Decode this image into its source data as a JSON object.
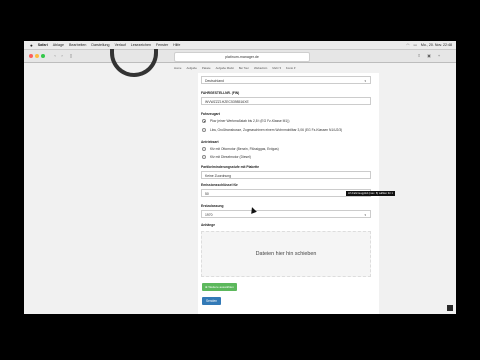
{
  "menubar": {
    "apple": "",
    "app": "Safari",
    "items": [
      "Ablage",
      "Bearbeiten",
      "Darstellung",
      "Verlauf",
      "Lesezeichen",
      "Fenster",
      "Hilfe"
    ],
    "clock": "Mo., 20. Nov. 22:48"
  },
  "toolbar": {
    "url": "platinum-manager.de"
  },
  "nav": {
    "items": [
      "Home",
      "Aufgabe",
      "Pakete",
      "Aufgabe Markt",
      "Bei Tour",
      "Webadmin",
      "Mehr ▾",
      "Konto ▾"
    ]
  },
  "form": {
    "top_select_value": "Deutschland",
    "fahrgestellnr_label": "FAHRGESTELLNR. (FIN)",
    "fahrgestellnr_value": "WVWZZZ1HZEC5398516XE",
    "fahrzeugart_label": "Fahrzeugart",
    "fahrzeugart_opt1": "Pkw (einer Werkmaßstab bis 2,8 t (EG Fz-Klasse M1))",
    "fahrzeugart_opt2": "Lkw, Großtransbusse, Zugmaschinen einem Wohnmobilbar 3,06 (EG Fz-Klassen N1/U2/3)",
    "antriebsart_label": "Antriebsart",
    "antriebsart_opt1": "Kfz mit Ottomotor (Benzin, Flüssiggas, Erdgas)",
    "antriebsart_opt2": "Kfz mit Dieselmotor (Diesel)",
    "partikelminderung_label": "Partikelminderungsstufe mit Plakette",
    "partikelminderung_value": "Keine Zuordnung",
    "emissionsschluessel_label": "Emissionsschlüssel für",
    "emissionsschluessel_value": "50",
    "tooltip": "Ich Fahrzeugpfeil (max. 8) wählen für 1",
    "erstzulassung_label": "Erstzulassung",
    "erstzulassung_value": "1970",
    "anhaenge_label": "Anhänge",
    "drop_text": "Dateien hier hin schieben",
    "add_button": "⊕ Weitere auswählen",
    "submit_button": "Senden"
  },
  "colors": {
    "green": "#5cb85c",
    "blue": "#337ab7"
  }
}
